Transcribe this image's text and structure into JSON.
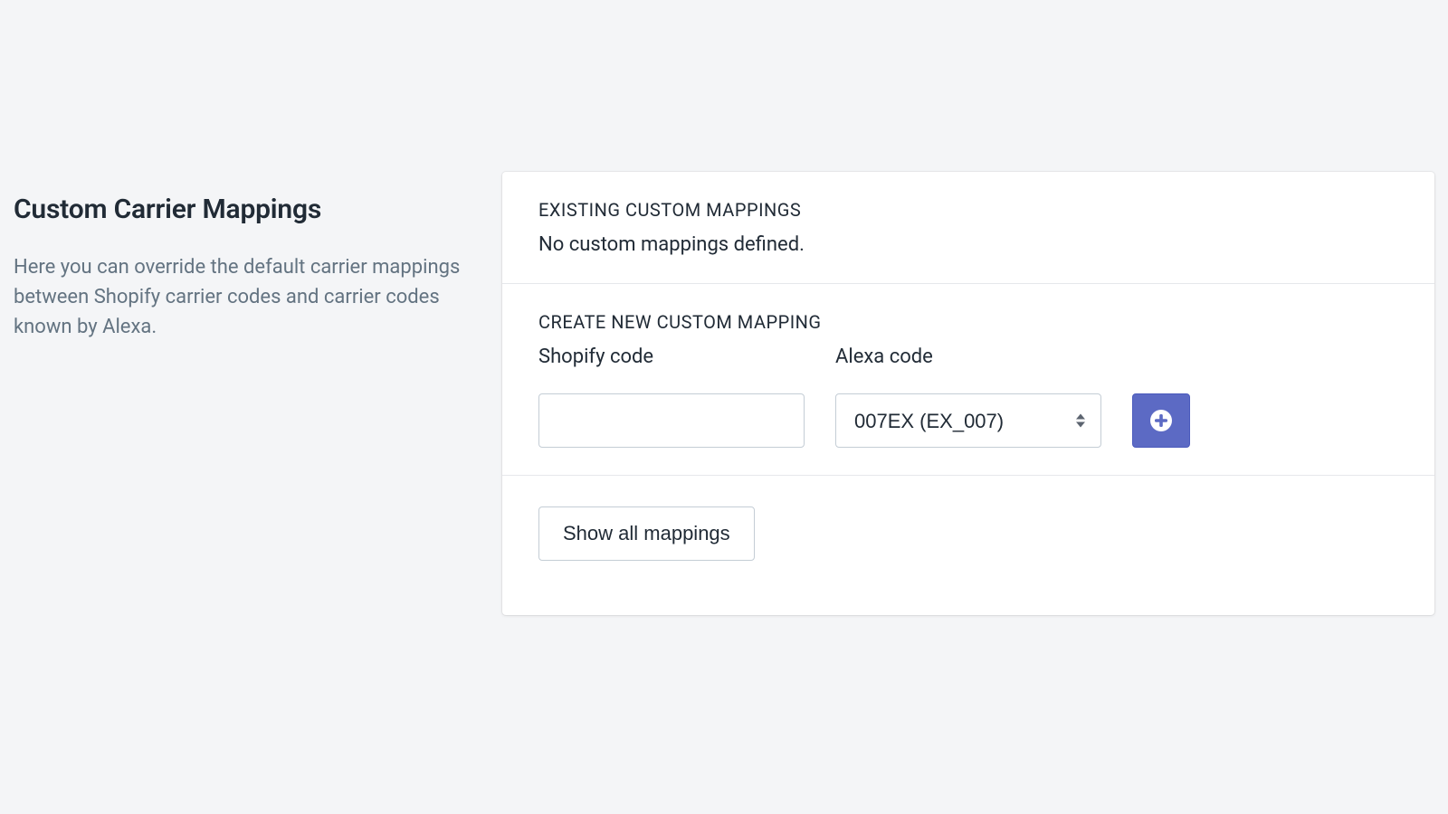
{
  "left": {
    "title": "Custom Carrier Mappings",
    "description": "Here you can override the default carrier mappings between Shopify carrier codes and carrier codes known by Alexa."
  },
  "existing": {
    "heading": "EXISTING CUSTOM MAPPINGS",
    "empty_message": "No custom mappings defined."
  },
  "create": {
    "heading": "CREATE NEW CUSTOM MAPPING",
    "shopify_label": "Shopify code",
    "alexa_label": "Alexa code",
    "shopify_value": "",
    "alexa_selected": "007EX (EX_007)"
  },
  "footer": {
    "show_all_label": "Show all mappings"
  }
}
